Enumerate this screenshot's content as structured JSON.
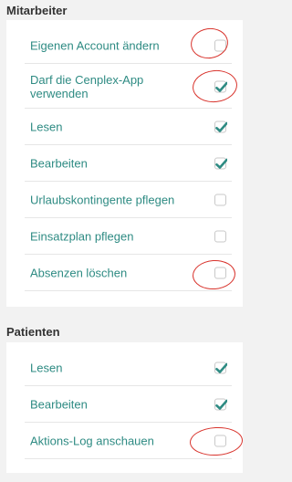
{
  "mitarbeiter": {
    "title": "Mitarbeiter",
    "items": [
      {
        "label": "Eigenen Account ändern",
        "checked": false
      },
      {
        "label": "Darf die Cenplex-App verwenden",
        "checked": true
      },
      {
        "label": "Lesen",
        "checked": true
      },
      {
        "label": "Bearbeiten",
        "checked": true
      },
      {
        "label": "Urlaubskontingente pflegen",
        "checked": false
      },
      {
        "label": "Einsatzplan pflegen",
        "checked": false
      },
      {
        "label": "Absenzen löschen",
        "checked": false
      }
    ]
  },
  "patienten": {
    "title": "Patienten",
    "items": [
      {
        "label": "Lesen",
        "checked": true
      },
      {
        "label": "Bearbeiten",
        "checked": true
      },
      {
        "label": "Aktions-Log anschauen",
        "checked": false
      }
    ]
  },
  "colors": {
    "background": "#f2f2f2",
    "label": "#2e8b83",
    "checkmark": "#2e8b83",
    "annotation": "#d8322b"
  },
  "icons": {
    "checkmark": "check-icon"
  }
}
